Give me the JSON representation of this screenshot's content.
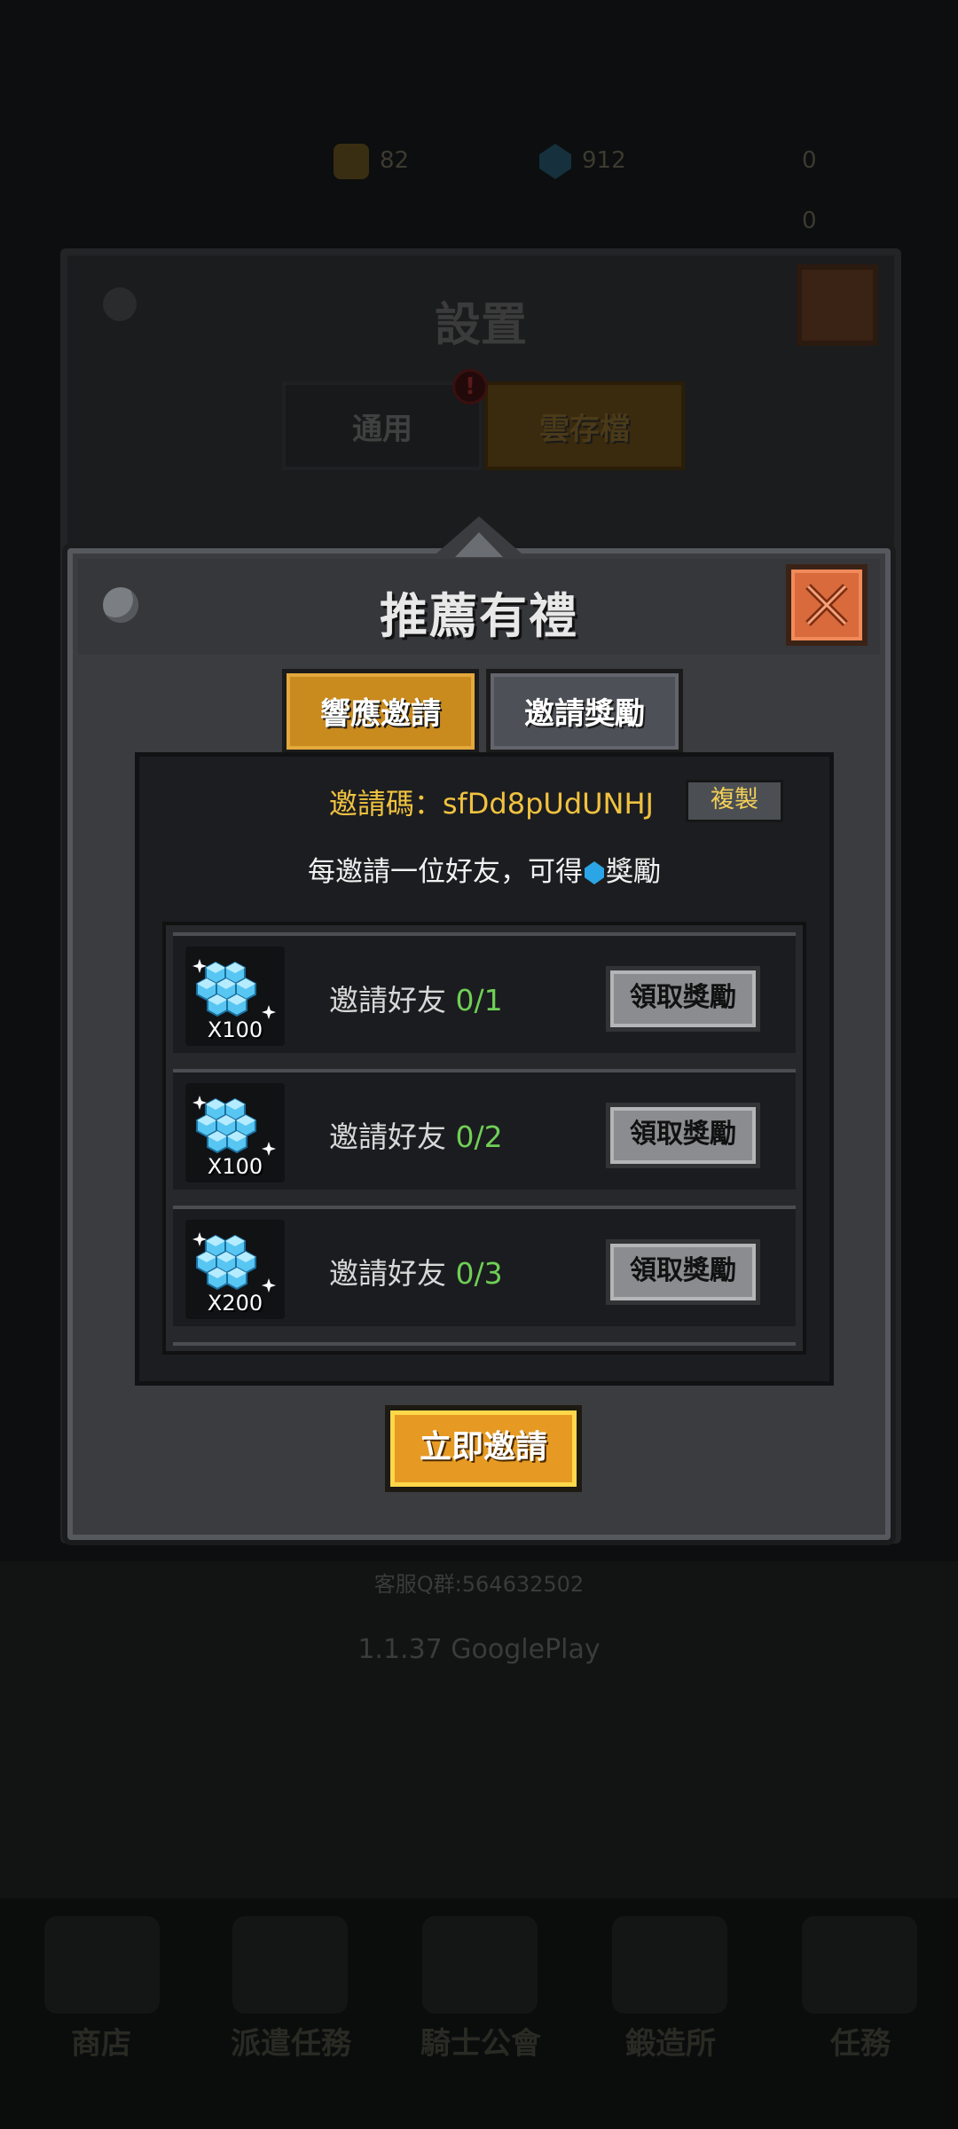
{
  "background": {
    "resources": [
      "82",
      "912",
      "0",
      "0"
    ],
    "support_group": "客服Q群:564632502",
    "version": "1.1.37 GooglePlay",
    "nav": [
      "商店",
      "派遣任務",
      "騎士公會",
      "鍛造所",
      "任務"
    ]
  },
  "settings_panel": {
    "title": "設置",
    "tabs": [
      "通用",
      "雲存檔"
    ],
    "alert": "!"
  },
  "dialog": {
    "title": "推薦有禮",
    "tabs": {
      "respond": "響應邀請",
      "rewards": "邀請獎勵"
    },
    "invite_code": "邀請碼：sfDd8pUdUNHJ",
    "copy_label": "複製",
    "info_prefix": "每邀請一位好友，可得",
    "info_suffix": "獎勵",
    "rows": [
      {
        "qty": "X100",
        "label": "邀請好友",
        "progress": "0/1",
        "button": "領取獎勵"
      },
      {
        "qty": "X100",
        "label": "邀請好友",
        "progress": "0/2",
        "button": "領取獎勵"
      },
      {
        "qty": "X200",
        "label": "邀請好友",
        "progress": "0/3",
        "button": "領取獎勵"
      }
    ],
    "invite_button": "立即邀請"
  },
  "colors": {
    "accent_orange": "#c98a1e",
    "gem_blue": "#2ba5e6",
    "progress_green": "#6fcf56",
    "code_yellow": "#f0c240",
    "close_orange": "#d86a3c"
  }
}
